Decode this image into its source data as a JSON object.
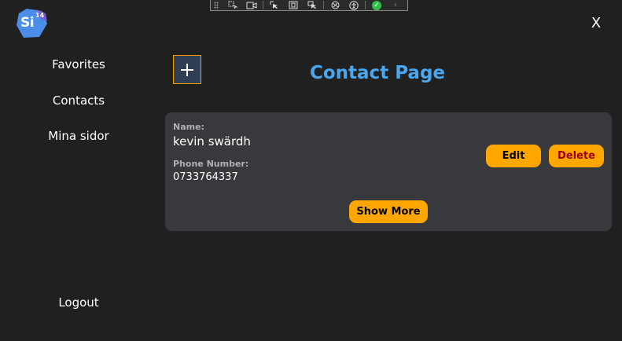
{
  "app": {
    "logo_text": "Si",
    "logo_sup": "14",
    "close_label": "X"
  },
  "devtools": {
    "icons": [
      "select-element-icon",
      "record-icon",
      "cursor-icon",
      "frame-icon",
      "cursor-icon",
      "binding-icon",
      "accessibility-icon",
      "check-icon",
      "collapse-icon"
    ]
  },
  "sidebar": {
    "items": [
      {
        "label": "Favorites"
      },
      {
        "label": "Contacts"
      },
      {
        "label": "Mina sidor"
      }
    ],
    "logout_label": "Logout"
  },
  "main": {
    "title": "Contact Page",
    "add_icon": "plus-icon"
  },
  "contact": {
    "name_label": "Name:",
    "name": "kevin swärdh",
    "phone_label": "Phone Number:",
    "phone": "0733764337",
    "edit_label": "Edit",
    "delete_label": "Delete",
    "show_more_label": "Show More"
  },
  "colors": {
    "background": "#202020",
    "card": "#38393c",
    "accent": "#ffa600",
    "title": "#49a7f0",
    "delete_text": "#a00000"
  }
}
